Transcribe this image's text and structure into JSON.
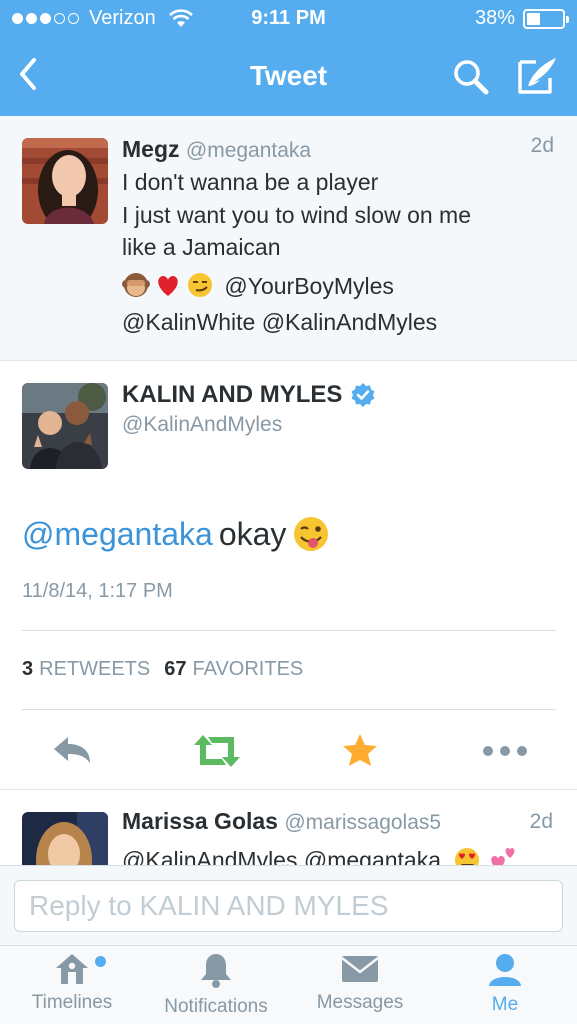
{
  "status_bar": {
    "carrier": "Verizon",
    "time": "9:11 PM",
    "battery_percent": "38%",
    "battery_level": 0.38,
    "signal_bars_filled": 3,
    "signal_bars_total": 5
  },
  "nav": {
    "title": "Tweet",
    "back_icon": "chevron-left-icon",
    "search_icon": "search-icon",
    "compose_icon": "compose-icon"
  },
  "parent_tweet": {
    "name": "Megz",
    "handle": "@megantaka",
    "age": "2d",
    "lines": [
      "I don't wanna be a player",
      "I just want you to wind slow on me",
      "like a Jamaican"
    ],
    "emojis": [
      "see-no-evil-monkey-icon",
      "red-heart-icon",
      "smirk-face-icon"
    ],
    "mention_1": "@YourBoyMyles",
    "mention_2": "@KalinWhite",
    "mention_3": "@KalinAndMyles"
  },
  "main_tweet": {
    "name": "KALIN AND MYLES",
    "handle": "@KalinAndMyles",
    "verified": true,
    "mention": "@megantaka",
    "text": "okay",
    "emoji": "winking-tongue-face-icon",
    "timestamp": "11/8/14, 1:17 PM",
    "retweets_count": "3",
    "retweets_label": "RETWEETS",
    "favorites_count": "67",
    "favorites_label": "FAVORITES"
  },
  "actions": [
    "reply-icon",
    "retweet-icon",
    "favorite-icon",
    "more-icon"
  ],
  "reply_preview": {
    "name": "Marissa Golas",
    "handle": "@marissagolas5",
    "age": "2d",
    "text": "@KalinAndMyles @megantaka"
  },
  "reply_bar": {
    "placeholder": "Reply to KALIN AND MYLES"
  },
  "tabs": [
    {
      "label": "Timelines",
      "icon": "home-icon",
      "has_badge": true
    },
    {
      "label": "Notifications",
      "icon": "bell-icon"
    },
    {
      "label": "Messages",
      "icon": "envelope-icon"
    },
    {
      "label": "Me",
      "icon": "person-icon",
      "active": true
    }
  ],
  "colors": {
    "brand_blue": "#55acee",
    "link_blue": "#3b94d9",
    "retweet_green": "#5cba61",
    "favorite_gold": "#ffac33",
    "muted_gray": "#8899a6"
  }
}
